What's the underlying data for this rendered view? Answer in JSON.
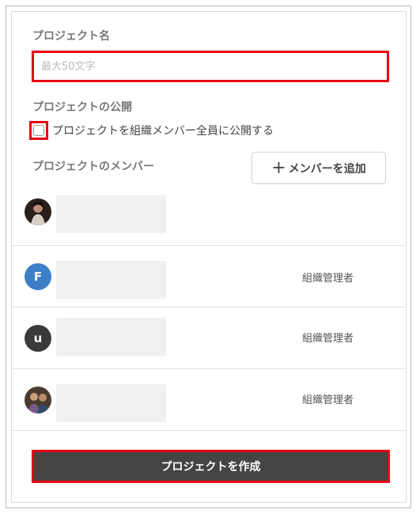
{
  "form": {
    "project_name_label": "プロジェクト名",
    "project_name_placeholder": "最大50文字",
    "project_name_value": "",
    "visibility_label": "プロジェクトの公開",
    "visibility_checkbox_label": "プロジェクトを組織メンバー全員に公開する",
    "visibility_checked": false,
    "members_label": "プロジェクトのメンバー",
    "add_member_button": "メンバーを追加",
    "create_button": "プロジェクトを作成"
  },
  "members": [
    {
      "avatar": "photo",
      "avatar_letter": "",
      "avatar_color": "#6b4a44",
      "role": ""
    },
    {
      "avatar": "letter",
      "avatar_letter": "F",
      "avatar_color": "#3d7ec9",
      "role": "組織管理者"
    },
    {
      "avatar": "letter",
      "avatar_letter": "u",
      "avatar_color": "#3a3a3a",
      "role": "組織管理者"
    },
    {
      "avatar": "photo",
      "avatar_letter": "",
      "avatar_color": "#5a4a3a",
      "role": "組織管理者"
    }
  ],
  "colors": {
    "highlight": "#e60012",
    "primary_button": "#444444"
  }
}
